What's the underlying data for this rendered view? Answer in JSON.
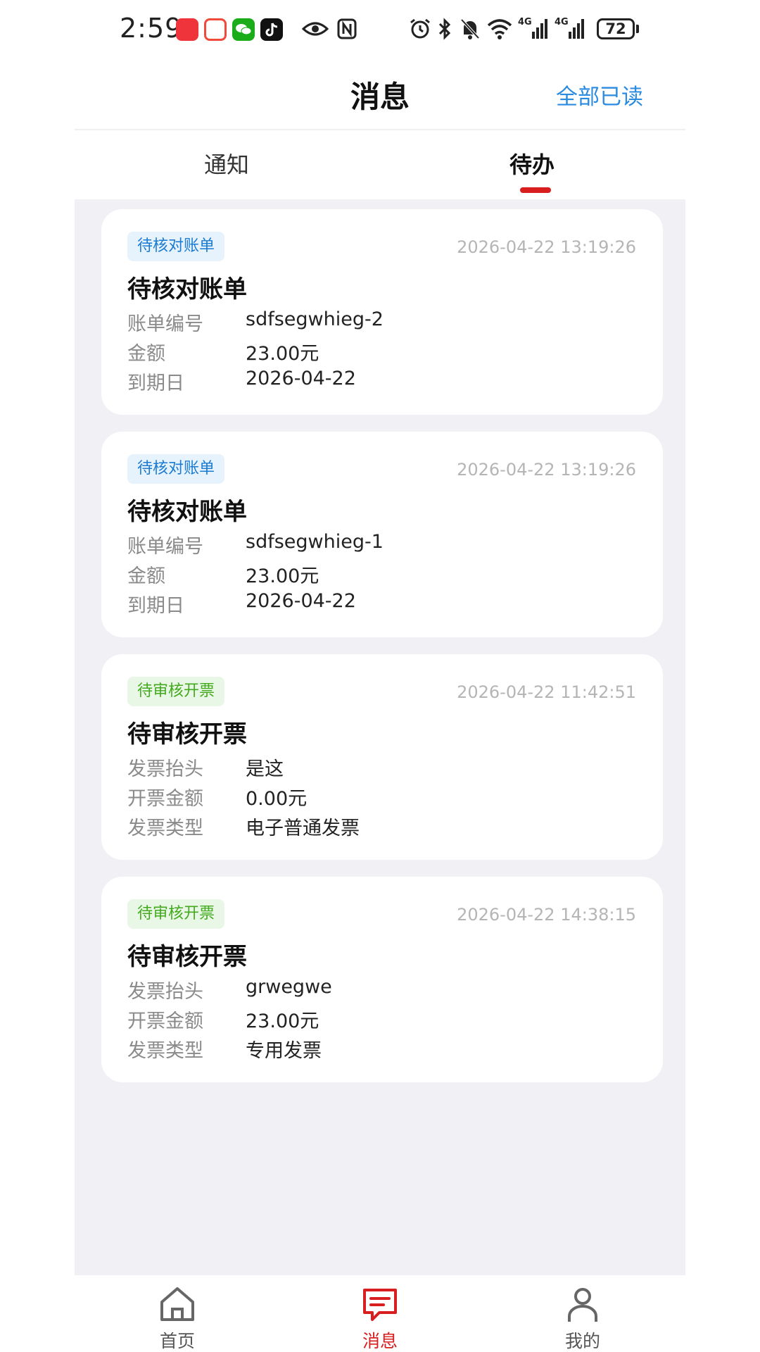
{
  "status_bar": {
    "time": "2:59",
    "apps": [
      {
        "icon": "huawei-app-icon",
        "color": "#f0343b"
      },
      {
        "icon": "game-app-icon",
        "color": "#f04a3a"
      },
      {
        "icon": "wechat-icon",
        "color": "#1aad19"
      },
      {
        "icon": "tiktok-icon",
        "color": "#111111"
      }
    ],
    "indicators": [
      "eye-icon",
      "nfc-icon",
      "alarm-icon",
      "bluetooth-icon",
      "mute-icon",
      "wifi-icon",
      "signal-icon",
      "signal-icon"
    ],
    "network_labels": [
      "4G",
      "4G"
    ],
    "battery": "72"
  },
  "header": {
    "title": "消息",
    "action_label": "全部已读"
  },
  "tabs": [
    {
      "label": "通知",
      "active": false
    },
    {
      "label": "待办",
      "active": true
    }
  ],
  "accent_colors": {
    "active": "#d81e1e",
    "link": "#2b8be0",
    "badge_blue": "#1b7bd2",
    "badge_green": "#43aa1e"
  },
  "cards": [
    {
      "badge": "待核对账单",
      "badge_color": "blue",
      "time": "2026-04-22 13:19:26",
      "title": "待核对账单",
      "rows": [
        {
          "label": "账单编号",
          "value": "sdfsegwhieg-2"
        },
        {
          "label": "金额",
          "value": "23.00元"
        },
        {
          "label": "到期日",
          "value": "2026-04-22"
        }
      ]
    },
    {
      "badge": "待核对账单",
      "badge_color": "blue",
      "time": "2026-04-22 13:19:26",
      "title": "待核对账单",
      "rows": [
        {
          "label": "账单编号",
          "value": "sdfsegwhieg-1"
        },
        {
          "label": "金额",
          "value": "23.00元"
        },
        {
          "label": "到期日",
          "value": "2026-04-22"
        }
      ]
    },
    {
      "badge": "待审核开票",
      "badge_color": "green",
      "time": "2026-04-22 11:42:51",
      "title": "待审核开票",
      "rows": [
        {
          "label": "发票抬头",
          "value": "是这"
        },
        {
          "label": "开票金额",
          "value": "0.00元"
        },
        {
          "label": "发票类型",
          "value": "电子普通发票"
        }
      ]
    },
    {
      "badge": "待审核开票",
      "badge_color": "green",
      "time": "2026-04-22 14:38:15",
      "title": "待审核开票",
      "rows": [
        {
          "label": "发票抬头",
          "value": "grwegwe"
        },
        {
          "label": "开票金额",
          "value": "23.00元"
        },
        {
          "label": "发票类型",
          "value": "专用发票"
        }
      ]
    }
  ],
  "bottom_nav": [
    {
      "label": "首页",
      "icon": "home-icon",
      "active": false
    },
    {
      "label": "消息",
      "icon": "message-icon",
      "active": true
    },
    {
      "label": "我的",
      "icon": "profile-icon",
      "active": false
    }
  ]
}
